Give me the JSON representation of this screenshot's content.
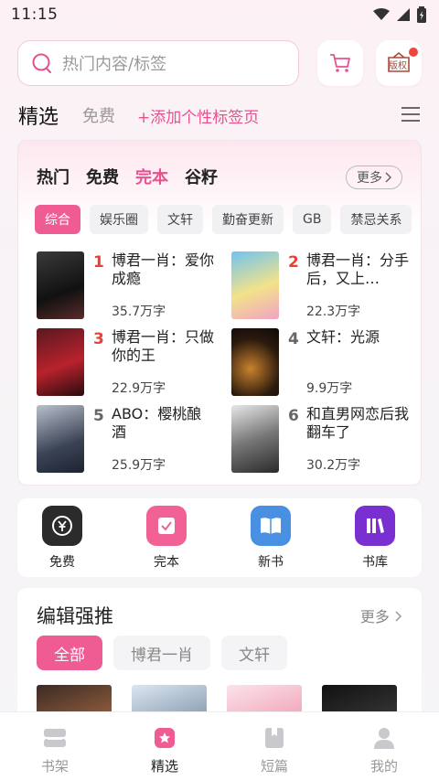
{
  "status": {
    "time": "11:15"
  },
  "search": {
    "placeholder": "热门内容/标签"
  },
  "header_icons": {
    "cart": "cart-icon",
    "copyright": "版权"
  },
  "top_tabs": {
    "selected": "精选",
    "free": "免费",
    "add": "+添加个性标签页"
  },
  "hot": {
    "tabs": [
      "热门",
      "免费",
      "完本",
      "谷籽"
    ],
    "active_tab": "完本",
    "more": "更多",
    "chips": [
      "综合",
      "娱乐圈",
      "文轩",
      "勤奋更新",
      "GB",
      "禁忌关系"
    ],
    "items": [
      {
        "rank": "1",
        "title": "博君一肖：爱你成瘾",
        "words": "35.7万字"
      },
      {
        "rank": "2",
        "title": "博君一肖：分手后，又上…",
        "words": "22.3万字"
      },
      {
        "rank": "3",
        "title": "博君一肖：只做你的王",
        "words": "22.9万字"
      },
      {
        "rank": "4",
        "title": "文轩：光源",
        "words": "9.9万字"
      },
      {
        "rank": "5",
        "title": "ABO：樱桃酿酒",
        "words": "25.9万字"
      },
      {
        "rank": "6",
        "title": "和直男网恋后我翻车了",
        "words": "30.2万字"
      }
    ]
  },
  "quick": [
    {
      "label": "免费"
    },
    {
      "label": "完本"
    },
    {
      "label": "新书"
    },
    {
      "label": "书库"
    }
  ],
  "editor": {
    "title": "编辑强推",
    "more": "更多",
    "pills": [
      "全部",
      "博君一肖",
      "文轩"
    ]
  },
  "nav": [
    "书架",
    "精选",
    "短篇",
    "我的"
  ],
  "colors": {
    "accent": "#ef5b93",
    "rank_red": "#e8413a"
  }
}
